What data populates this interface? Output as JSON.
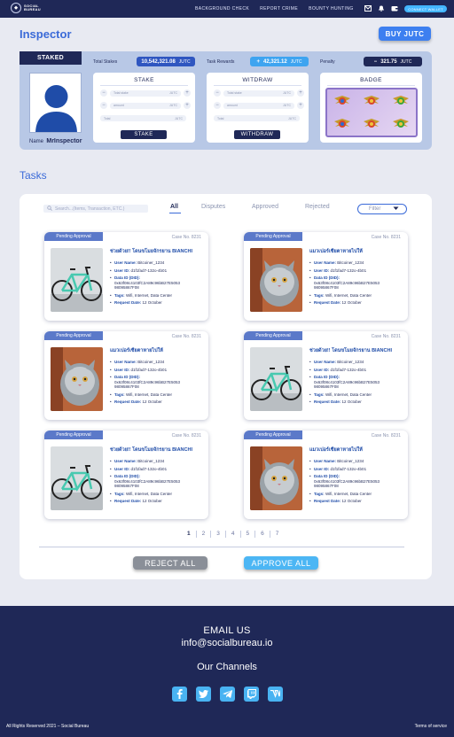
{
  "nav": {
    "logo_text_1": "SOCIAL",
    "logo_text_2": "BUREAU",
    "links": [
      "BACKGROUND CHECK",
      "REPORT CRIME",
      "BOUNTY HUNTING"
    ],
    "connect_wallet": "CONNECT WALLET"
  },
  "header": {
    "title": "Inspector",
    "buy_label": "BUY JUTC"
  },
  "profile": {
    "staked_tab": "STAKED",
    "name_label": "Name",
    "name_value": "MrInspector"
  },
  "stats": {
    "total_stakes_label": "Total Stakes",
    "total_stakes_value": "10,542,321.08",
    "task_rewards_label": "Task Rewards",
    "task_rewards_value": "42,321.12",
    "penalty_label": "Penalty",
    "penalty_value": "321.75",
    "unit": "JUTC"
  },
  "stake_card": {
    "title": "STAKE",
    "field1_placeholder": "Total stake",
    "field2_placeholder": "amount",
    "field3_placeholder": "Total",
    "unit": "JUTC",
    "button": "STAKE"
  },
  "withdraw_card": {
    "title": "WITDRAW",
    "field1_placeholder": "Total stake",
    "field2_placeholder": "amount",
    "field3_placeholder": "Total",
    "unit": "JUTC",
    "button": "WITHDRAW"
  },
  "badge_card": {
    "title": "BADGE"
  },
  "tasks": {
    "title": "Tasks",
    "search_placeholder": "Search...(Items, Transaction, ETC.)",
    "tabs": [
      "All",
      "Disputes",
      "Approved",
      "Rejected"
    ],
    "filter_label": "Filter",
    "cards": [
      {
        "status": "Pending Approval",
        "case": "Case No. 8231",
        "title": "ช่วยด้วย!! โดนขโมยจักรยาน BIANCHI",
        "user_name": "Bitcoiner_1234",
        "user_id": "d1f1fad7-132o-4b01",
        "did": "0x63f08c4103fC2A89c96bB27E5053 98095867F08",
        "tags": "Wifi, Internet, Data Center",
        "date": "12 October",
        "image": "bicycle"
      },
      {
        "status": "Pending Approval",
        "case": "Case No. 8231",
        "title": "แมวเปอร์เซียตาหายไปให้",
        "user_name": "Bitcoiner_1234",
        "user_id": "d1f1fad7-132o-4b01",
        "did": "0x63f08c4103fC2A89c96bB27E5053 98095867F08",
        "tags": "Wifi, Internet, Data Center",
        "date": "12 October",
        "image": "cat"
      },
      {
        "status": "Pending Approval",
        "case": "Case No. 8231",
        "title": "แมวเปอร์เซียตาหายไปให้",
        "user_name": "Bitcoiner_1234",
        "user_id": "d1f1fad7-132o-4b01",
        "did": "0x63f08c4103fC2A89c96bB27E5053 98095867F08",
        "tags": "Wifi, Internet, Data Center",
        "date": "12 October",
        "image": "cat"
      },
      {
        "status": "Pending Approval",
        "case": "Case No. 8231",
        "title": "ช่วยด้วย!! โดนขโมยจักรยาน BIANCHI",
        "user_name": "Bitcoiner_1234",
        "user_id": "d1f1fad7-132o-4b01",
        "did": "0x63f08c4103fC2A89c96bB27E5053 98095867F08",
        "tags": "Wifi, Internet, Data Center",
        "date": "12 October",
        "image": "bicycle"
      },
      {
        "status": "Pending Approval",
        "case": "Case No. 8231",
        "title": "ช่วยด้วย!! โดนขโมยจักรยาน BIANCHI",
        "user_name": "Bitcoiner_1234",
        "user_id": "d1f1fad7-132o-4b01",
        "did": "0x63f08c4103fC2A89c96bB27E5053 98095867F08",
        "tags": "Wifi, Internet, Data Center",
        "date": "12 October",
        "image": "bicycle"
      },
      {
        "status": "Pending Approval",
        "case": "Case No. 8231",
        "title": "แมวเปอร์เซียตาหายไปให้",
        "user_name": "Bitcoiner_1234",
        "user_id": "d1f1fad7-132o-4b01",
        "did": "0x63f08c4103fC2A89c96bB27E5053 98095867F08",
        "tags": "Wifi, Internet, Data Center",
        "date": "12 October",
        "image": "cat"
      }
    ],
    "labels": {
      "user_name": "User Name:",
      "user_id": "User ID:",
      "did": "Data ID (DID):",
      "tags": "Tags:",
      "date": "Request Date:"
    },
    "pages": [
      "1",
      "2",
      "3",
      "4",
      "5",
      "6",
      "7"
    ],
    "reject_all": "REJECT ALL",
    "approve_all": "APPROVE ALL"
  },
  "footer": {
    "email_title": "EMAIL US",
    "email": "info@socialbureau.io",
    "channels_title": "Our Channels",
    "social": [
      "f",
      "t",
      "tg",
      "tw",
      "w"
    ],
    "copyright": "All Rights Reserved 2021 – Social Bureau",
    "terms": "Terms of service"
  },
  "colors": {
    "navy": "#1f2857",
    "accent_blue": "#3a6ad8",
    "light_blue": "#4cb6f4",
    "panel": "#b8c8e6"
  }
}
